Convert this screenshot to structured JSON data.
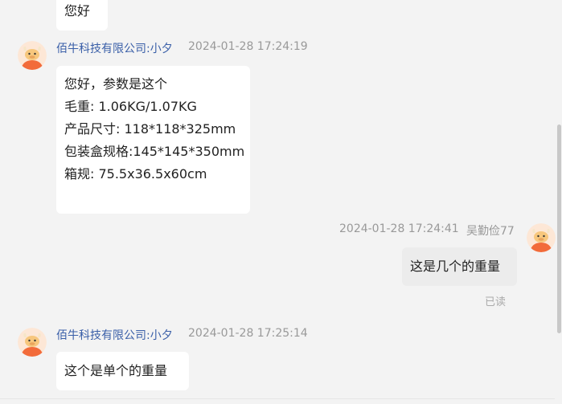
{
  "messages": [
    {
      "side": "in",
      "text_lines": [
        "您好"
      ]
    },
    {
      "side": "in",
      "sender": "佰牛科技有限公司:小夕",
      "time": "2024-01-28 17:24:19",
      "text_lines": [
        "您好，参数是这个",
        "毛重: 1.06KG/1.07KG",
        "产品尺寸: 118*118*325mm",
        "包装盒规格:145*145*350mm",
        "箱规: 75.5x36.5x60cm"
      ]
    },
    {
      "side": "out",
      "sender": "吴勤俭77",
      "time": "2024-01-28 17:24:41",
      "text_lines": [
        "这是几个的重量"
      ],
      "status": "已读"
    },
    {
      "side": "in",
      "sender": "佰牛科技有限公司:小夕",
      "time": "2024-01-28 17:25:14",
      "text_lines": [
        "这个是单个的重量"
      ]
    }
  ],
  "avatar_icon": "ox-mascot-icon",
  "colors": {
    "background": "#f3f3f3",
    "incoming_bubble": "#ffffff",
    "outgoing_bubble": "#ececec",
    "sender_name": "#3a5fa8",
    "muted_text": "#999999",
    "avatar_body": "#f26b3a",
    "avatar_face": "#f7c77d"
  }
}
